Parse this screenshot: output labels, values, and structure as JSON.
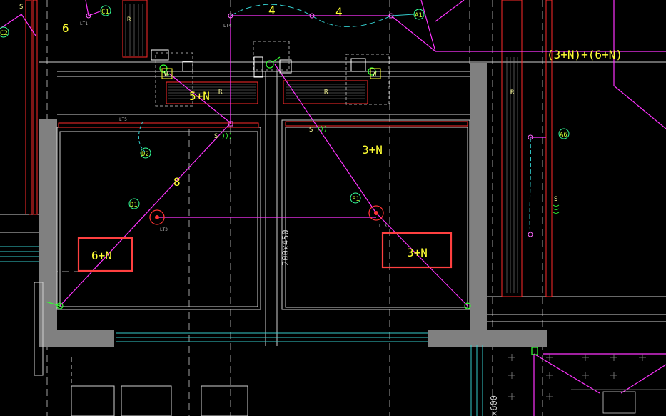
{
  "drawing": {
    "background": "#000000",
    "colors": {
      "wall_fill": "#808080",
      "room_line": "#d0d0d0",
      "magenta_circuit": "#ff33ff",
      "cyan_circuit": "#33cccc",
      "red_equipment": "#ff2a2a",
      "yellow_text": "#ffff33",
      "green_symbol": "#33ff33",
      "highlight_box": "#ff4040",
      "dashed_grid": "#a0a0a0"
    },
    "labels": {
      "circuit_top_6": "6",
      "circuit_4a": "4",
      "circuit_4b": "4",
      "circuit_5n": "5+N",
      "circuit_8": "8",
      "circuit_3n_mid": "3+N",
      "circuit_combo": "(3+N)+(6+N)",
      "box_left": "6+N",
      "box_right": "3+N",
      "duct_size": "200x450",
      "duct_size_bottom": "x600"
    },
    "callouts": {
      "c1": "C1",
      "c2": "C2",
      "a1": "A1",
      "a6": "A6",
      "d1": "D1",
      "d2": "D2",
      "f1": "F1"
    },
    "tags": {
      "r": "R",
      "w": "W",
      "s": "S",
      "lt": "LT3",
      "lt5": "LT5",
      "lt4": "LT4",
      "lt1": "LT1"
    },
    "icons": [
      "junction-symbol",
      "switch-symbol",
      "fan-coil-symbol"
    ]
  }
}
